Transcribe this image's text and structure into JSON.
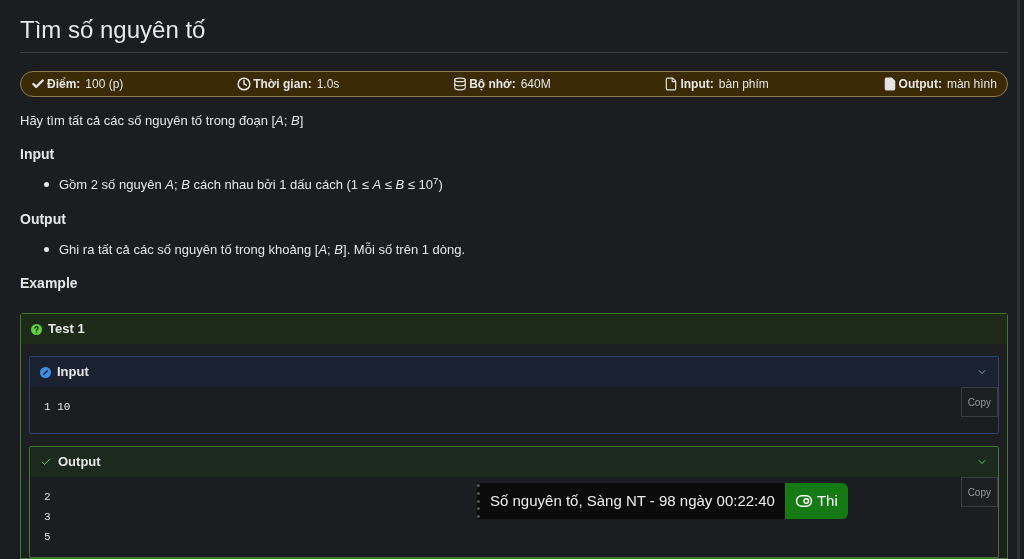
{
  "title": "Tìm số nguyên tố",
  "info": [
    {
      "kind": "check",
      "label": "Điểm:",
      "value": "100 (p)"
    },
    {
      "kind": "clock",
      "label": "Thời gian:",
      "value": "1.0s"
    },
    {
      "kind": "memory",
      "label": "Bộ nhớ:",
      "value": "640M"
    },
    {
      "kind": "file",
      "label": "Input:",
      "value": "bàn phím"
    },
    {
      "kind": "file-filled",
      "label": "Output:",
      "value": "màn hình"
    }
  ],
  "statement": "Hãy tìm tất cả các số nguyên tố trong đoạn [*A*; *B*]",
  "sections": [
    {
      "heading": "Input",
      "bullets": [
        "Gồm 2 số nguyên *A*;  *B* cách nhau bởi 1 dấu cách (1 ≤ *A* ≤ *B* ≤ 10$^{7}$)"
      ]
    },
    {
      "heading": "Output",
      "bullets": [
        "Ghi ra tất cả các số nguyên tố trong khoảng [*A*; *B*]. Mỗi số trên 1 dòng."
      ]
    }
  ],
  "example_heading": "Example",
  "test": {
    "title": "Test 1",
    "blocks": [
      {
        "kind": "input",
        "title": "Input",
        "expanded": true,
        "lines": [
          "1 10"
        ],
        "copy": "Copy"
      },
      {
        "kind": "output",
        "title": "Output",
        "expanded": true,
        "lines": [
          "2",
          "3",
          "5"
        ],
        "copy": "Copy"
      }
    ]
  },
  "floating_bar": {
    "text": "Số nguyên tố, Sàng NT - 98 ngày 00:22:40",
    "toggle": {
      "label": "Thi",
      "on": true
    }
  }
}
